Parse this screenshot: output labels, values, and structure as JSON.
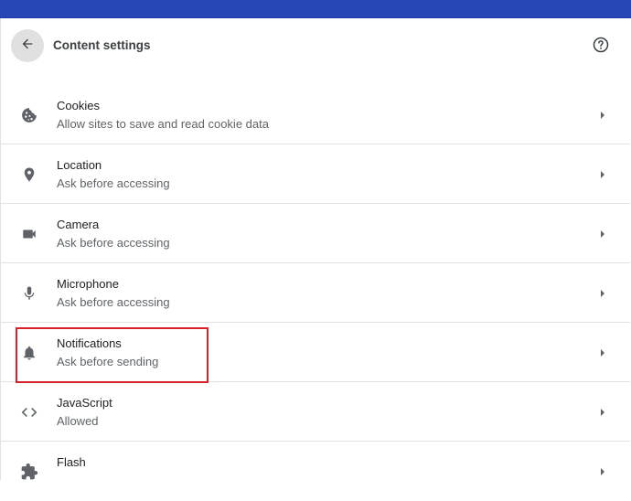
{
  "header": {
    "title": "Content settings",
    "back_icon": "arrow-back-icon",
    "help_icon": "help-icon"
  },
  "colors": {
    "top_bar": "#2647b5",
    "highlight": "#d9212c",
    "icon": "#5f6368"
  },
  "settings": [
    {
      "id": "cookies",
      "icon": "cookie-icon",
      "title": "Cookies",
      "subtitle": "Allow sites to save and read cookie data"
    },
    {
      "id": "location",
      "icon": "location-pin-icon",
      "title": "Location",
      "subtitle": "Ask before accessing"
    },
    {
      "id": "camera",
      "icon": "camera-icon",
      "title": "Camera",
      "subtitle": "Ask before accessing"
    },
    {
      "id": "microphone",
      "icon": "microphone-icon",
      "title": "Microphone",
      "subtitle": "Ask before accessing"
    },
    {
      "id": "notifications",
      "icon": "bell-icon",
      "title": "Notifications",
      "subtitle": "Ask before sending",
      "highlighted": true
    },
    {
      "id": "javascript",
      "icon": "code-icon",
      "title": "JavaScript",
      "subtitle": "Allowed"
    },
    {
      "id": "flash",
      "icon": "puzzle-icon",
      "title": "Flash",
      "subtitle": ""
    }
  ]
}
